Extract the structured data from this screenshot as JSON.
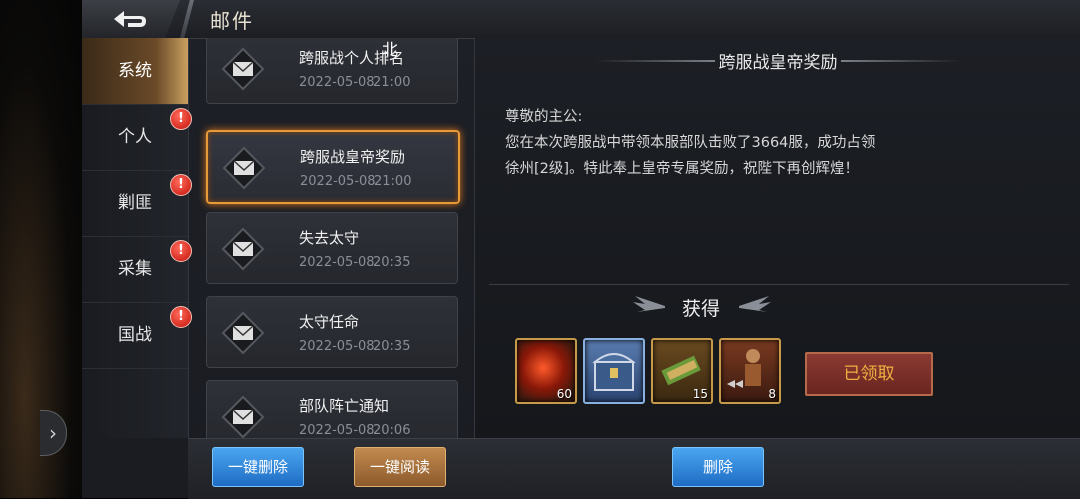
{
  "window": {
    "title": "邮件"
  },
  "sidebar": {
    "items": [
      {
        "label": "系统",
        "active": true,
        "badge": false
      },
      {
        "label": "个人",
        "active": false,
        "badge": true
      },
      {
        "label": "剿匪",
        "active": false,
        "badge": true
      },
      {
        "label": "采集",
        "active": false,
        "badge": true
      },
      {
        "label": "国战",
        "active": false,
        "badge": true
      }
    ],
    "badge_text": "!"
  },
  "overlay_label": "北",
  "mails": [
    {
      "title": "跨服战个人排名",
      "date": "2022-05-08",
      "time": "21:00"
    },
    {
      "title": "跨服战皇帝奖励",
      "date": "2022-05-08",
      "time": "21:00",
      "selected": true
    },
    {
      "title": "失去太守",
      "date": "2022-05-08",
      "time": "20:35"
    },
    {
      "title": "太守任命",
      "date": "2022-05-08",
      "time": "20:35"
    },
    {
      "title": "部队阵亡通知",
      "date": "2022-05-08",
      "time": "20:06"
    }
  ],
  "detail": {
    "title": "跨服战皇帝奖励",
    "greeting": "尊敬的主公:",
    "body": "您在本次跨服战中带领本服部队击败了3664服，成功占领徐州[2级]。特此奉上皇帝专属奖励，祝陛下再创辉煌！",
    "obtain_label": "获得",
    "rewards": [
      {
        "icon": "red-orb-icon",
        "count": "60"
      },
      {
        "icon": "treasure-chest-icon",
        "count": ""
      },
      {
        "icon": "scroll-icon",
        "count": "15"
      },
      {
        "icon": "warrior-icon",
        "count": "8"
      }
    ],
    "claimed_label": "已领取"
  },
  "actions": {
    "delete_all": "一键删除",
    "read_all": "一键阅读",
    "delete": "删除"
  },
  "colors": {
    "accent_orange": "#e79a3a",
    "blue_button": "#1f6cc4",
    "badge_red": "#c4120a"
  }
}
